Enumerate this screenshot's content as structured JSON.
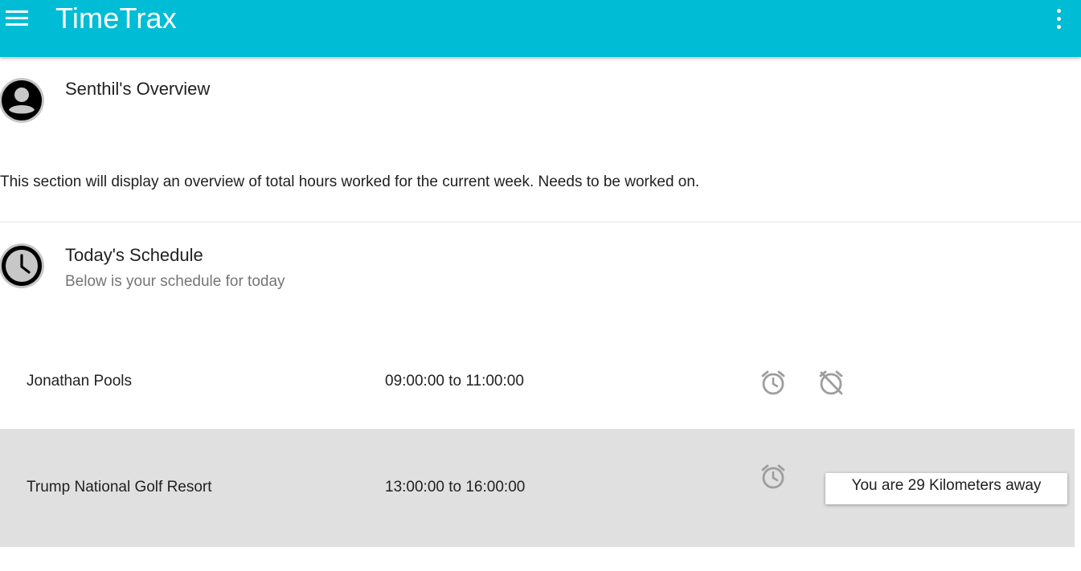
{
  "app": {
    "title": "TimeTrax",
    "brand_color": "#00bcd4"
  },
  "header": {
    "menu_icon": "menu-icon",
    "more_icon": "more-vert-icon"
  },
  "overview": {
    "icon": "account-circle-icon",
    "title": "Senthil's Overview",
    "description": "This section will display an overview of total hours worked for the current week. Needs to be worked on."
  },
  "schedule": {
    "icon": "clock-icon",
    "title": "Today's Schedule",
    "subtitle": "Below is your schedule for today",
    "rows": [
      {
        "name": "Jonathan Pools",
        "time": "09:00:00 to 11:00:00",
        "clock_in_icon": "alarm-icon",
        "clock_out_icon": "alarm-off-icon"
      },
      {
        "name": "Trump National Golf Resort",
        "time": "13:00:00 to 16:00:00",
        "clock_in_icon": "alarm-icon",
        "distance_message": "You are 29 Kilometers away"
      }
    ]
  }
}
